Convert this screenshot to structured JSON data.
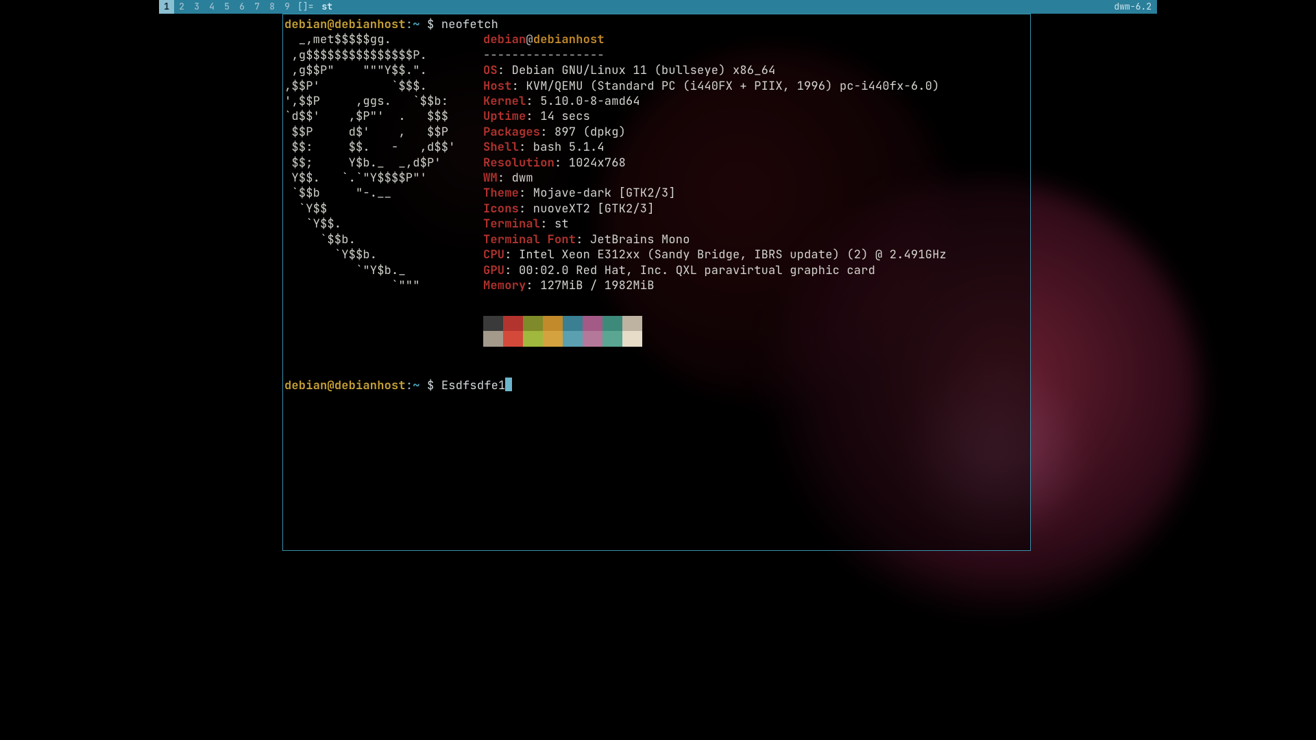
{
  "bar": {
    "tags": [
      "1",
      "2",
      "3",
      "4",
      "5",
      "6",
      "7",
      "8",
      "9"
    ],
    "active_tag_index": 0,
    "layout": "[]=",
    "title": "st",
    "status": "dwm-6.2"
  },
  "prompt1": {
    "user": "debian",
    "host": "debianhost",
    "path": "~",
    "command": "neofetch"
  },
  "neofetch": {
    "header_user": "debian",
    "header_host": "debianhost",
    "separator": "-----------------",
    "info": [
      {
        "k": "OS",
        "v": "Debian GNU/Linux 11 (bullseye) x86_64"
      },
      {
        "k": "Host",
        "v": "KVM/QEMU (Standard PC (i440FX + PIIX, 1996) pc-i440fx-6.0)"
      },
      {
        "k": "Kernel",
        "v": "5.10.0-8-amd64"
      },
      {
        "k": "Uptime",
        "v": "14 secs"
      },
      {
        "k": "Packages",
        "v": "897 (dpkg)"
      },
      {
        "k": "Shell",
        "v": "bash 5.1.4"
      },
      {
        "k": "Resolution",
        "v": "1024x768"
      },
      {
        "k": "WM",
        "v": "dwm"
      },
      {
        "k": "Theme",
        "v": "Mojave-dark [GTK2/3]"
      },
      {
        "k": "Icons",
        "v": "nuoveXT2 [GTK2/3]"
      },
      {
        "k": "Terminal",
        "v": "st"
      },
      {
        "k": "Terminal Font",
        "v": "JetBrains Mono"
      },
      {
        "k": "CPU",
        "v": "Intel Xeon E312xx (Sandy Bridge, IBRS update) (2) @ 2.491GHz"
      },
      {
        "k": "GPU",
        "v": "00:02.0 Red Hat, Inc. QXL paravirtual graphic card"
      },
      {
        "k": "Memory",
        "v": "127MiB / 1982MiB"
      }
    ],
    "logo": [
      "  _,met$$$$$gg.",
      " ,g$$$$$$$$$$$$$$$P.",
      " ,g$$P\"    \"\"\"Y$$.\".",
      ",$$P'          `$$$.",
      "',$$P     ,ggs.   `$$b:",
      "`d$$'    ,$P\"'  .   $$$",
      " $$P     d$'    ,   $$P",
      " $$:     $$.   -   ,d$$'",
      " $$;     Y$b._  _,d$P'",
      " Y$$.   `.`\"Y$$$$P\"'",
      " `$$b     \"-.__",
      "  `Y$$",
      "   `Y$$.",
      "     `$$b.",
      "       `Y$$b.",
      "          `\"Y$b._",
      "               `\"\"\""
    ],
    "colors_row1": [
      "#3a3a3a",
      "#b3332e",
      "#7f8a2a",
      "#c28a2a",
      "#3a7f92",
      "#a35a86",
      "#3e8a7a",
      "#beb2a0"
    ],
    "colors_row2": [
      "#a49a8c",
      "#d34a3a",
      "#a0b83e",
      "#d4a23e",
      "#5aa0b0",
      "#b4789a",
      "#5aa692",
      "#e6dcc8"
    ]
  },
  "prompt2": {
    "user": "debian",
    "host": "debianhost",
    "path": "~",
    "command": "Esdfsdfe1"
  }
}
